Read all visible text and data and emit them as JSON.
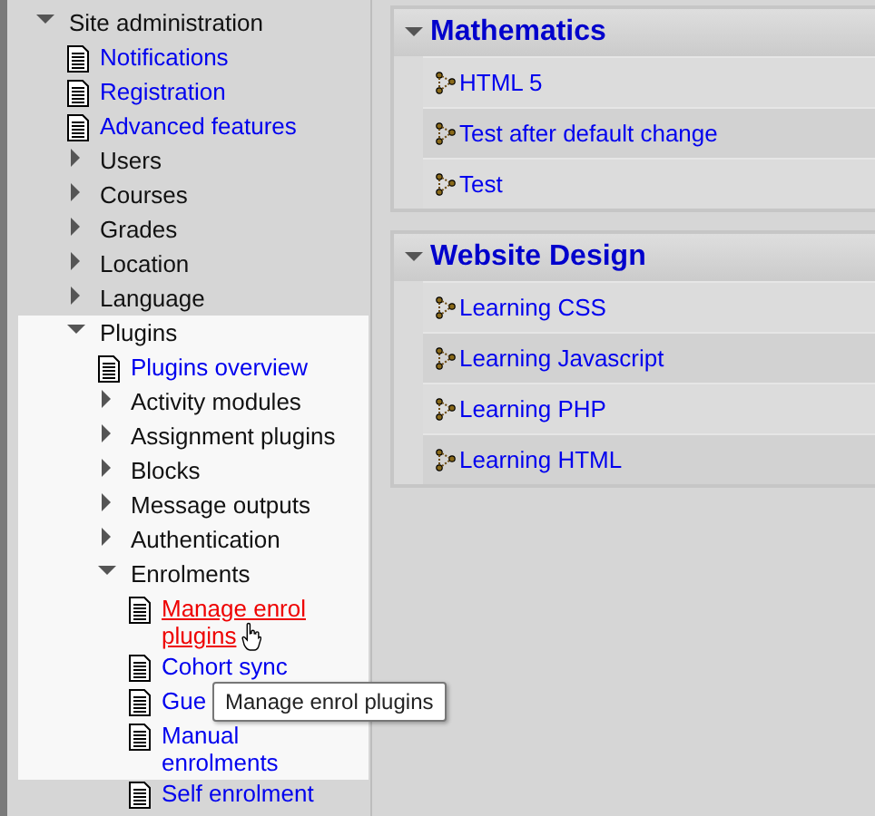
{
  "sidebar": {
    "tree": [
      {
        "label": "Site administration",
        "kind": "folder",
        "expanded": true,
        "children": [
          {
            "label": "Notifications",
            "kind": "page",
            "hovered": false
          },
          {
            "label": "Registration",
            "kind": "page",
            "hovered": false
          },
          {
            "label": "Advanced features",
            "kind": "page",
            "hovered": false
          },
          {
            "label": "Users",
            "kind": "folder",
            "expanded": false
          },
          {
            "label": "Courses",
            "kind": "folder",
            "expanded": false
          },
          {
            "label": "Grades",
            "kind": "folder",
            "expanded": false
          },
          {
            "label": "Location",
            "kind": "folder",
            "expanded": false
          },
          {
            "label": "Language",
            "kind": "folder",
            "expanded": false
          },
          {
            "label": "Plugins",
            "kind": "folder",
            "expanded": true,
            "children": [
              {
                "label": "Plugins overview",
                "kind": "page",
                "hovered": false
              },
              {
                "label": "Activity modules",
                "kind": "folder",
                "expanded": false
              },
              {
                "label": "Assignment plugins",
                "kind": "folder",
                "expanded": false
              },
              {
                "label": "Blocks",
                "kind": "folder",
                "expanded": false
              },
              {
                "label": "Message outputs",
                "kind": "folder",
                "expanded": false
              },
              {
                "label": "Authentication",
                "kind": "folder",
                "expanded": false
              },
              {
                "label": "Enrolments",
                "kind": "folder",
                "expanded": true,
                "children": [
                  {
                    "label": "Manage enrol plugins",
                    "kind": "page",
                    "hovered": true
                  },
                  {
                    "label": "Cohort sync",
                    "kind": "page",
                    "hovered": false
                  },
                  {
                    "label": "Gue",
                    "kind": "page",
                    "hovered": false
                  },
                  {
                    "label": "Manual enrolments",
                    "kind": "page",
                    "hovered": false
                  },
                  {
                    "label": "Self enrolment",
                    "kind": "page",
                    "hovered": false
                  }
                ]
              }
            ]
          }
        ]
      }
    ]
  },
  "tooltip": {
    "text": "Manage enrol plugins"
  },
  "categories": [
    {
      "title": "Mathematics",
      "expanded": true,
      "courses": [
        "HTML 5",
        "Test after default change",
        "Test"
      ]
    },
    {
      "title": "Website Design",
      "expanded": true,
      "courses": [
        "Learning CSS",
        "Learning Javascript",
        "Learning PHP",
        "Learning HTML"
      ]
    }
  ]
}
